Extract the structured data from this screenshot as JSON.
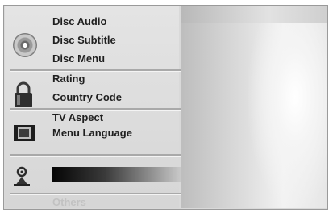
{
  "menu": {
    "groups": [
      {
        "icon": "disc-icon",
        "items": [
          "Disc Audio",
          "Disc Subtitle",
          "Disc Menu"
        ]
      },
      {
        "icon": "lock-icon",
        "items": [
          "Rating",
          "Country Code"
        ]
      },
      {
        "icon": "tv-icon",
        "items": [
          "TV Aspect",
          "Menu Language"
        ]
      },
      {
        "icon": "speaker-icon",
        "items": [
          ""
        ]
      }
    ],
    "others_label": "Others"
  },
  "colors": {
    "panel": "#d9d9d9",
    "text": "#1f1f1f",
    "dim_text": "#c2c2c2",
    "selection": "#050505"
  }
}
